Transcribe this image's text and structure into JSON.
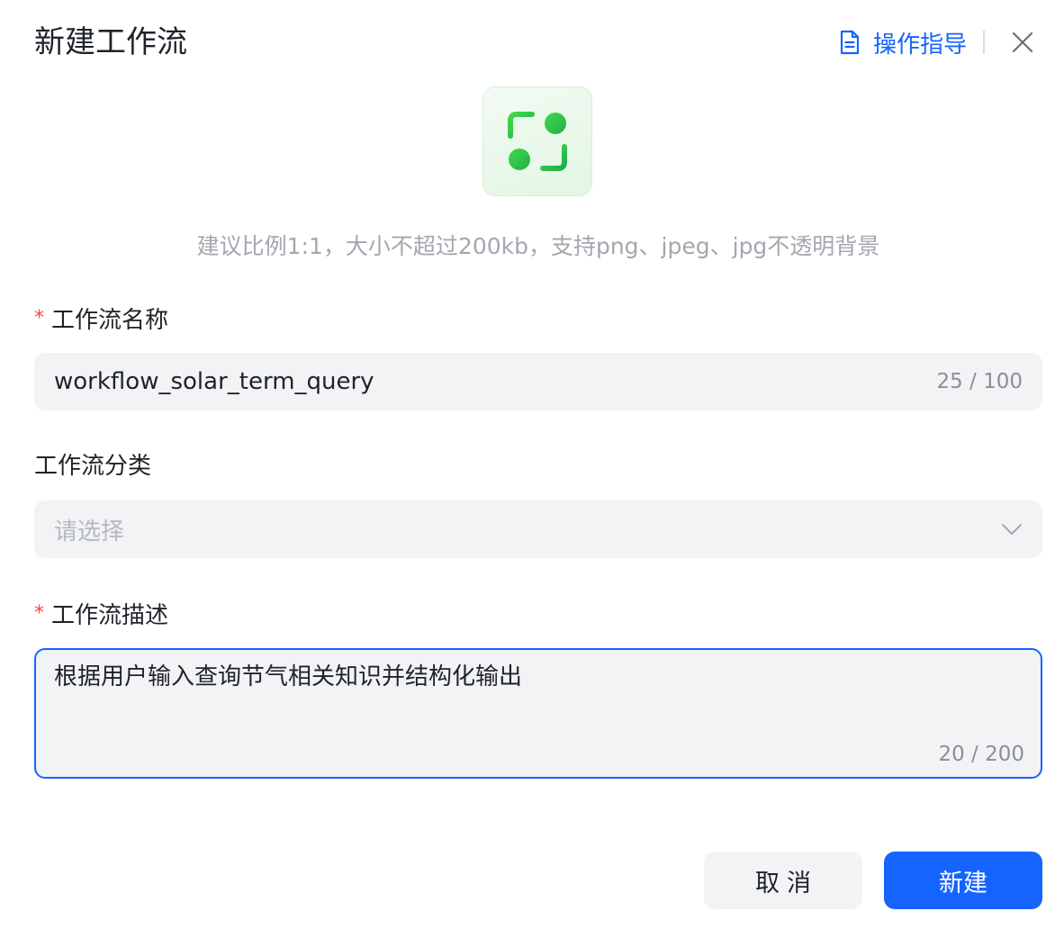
{
  "dialog": {
    "title": "新建工作流",
    "guide_label": "操作指导",
    "avatar_hint": "建议比例1:1，大小不超过200kb，支持png、jpeg、jpg不透明背景"
  },
  "fields": {
    "name": {
      "label": "工作流名称",
      "required_mark": "*",
      "value": "workflow_solar_term_query",
      "counter": "25 / 100"
    },
    "category": {
      "label": "工作流分类",
      "placeholder": "请选择"
    },
    "description": {
      "label": "工作流描述",
      "required_mark": "*",
      "value": "根据用户输入查询节气相关知识并结构化输出",
      "counter": "20 / 200"
    }
  },
  "buttons": {
    "cancel_label": "取消",
    "create_label": "新建"
  },
  "colors": {
    "accent": "#1664ff",
    "required": "#f54a45",
    "icon_green": "#1fc14d"
  },
  "icons": {
    "guide": "document-icon",
    "close": "close-icon",
    "select": "chevron-down-icon",
    "avatar": "workflow-icon"
  }
}
